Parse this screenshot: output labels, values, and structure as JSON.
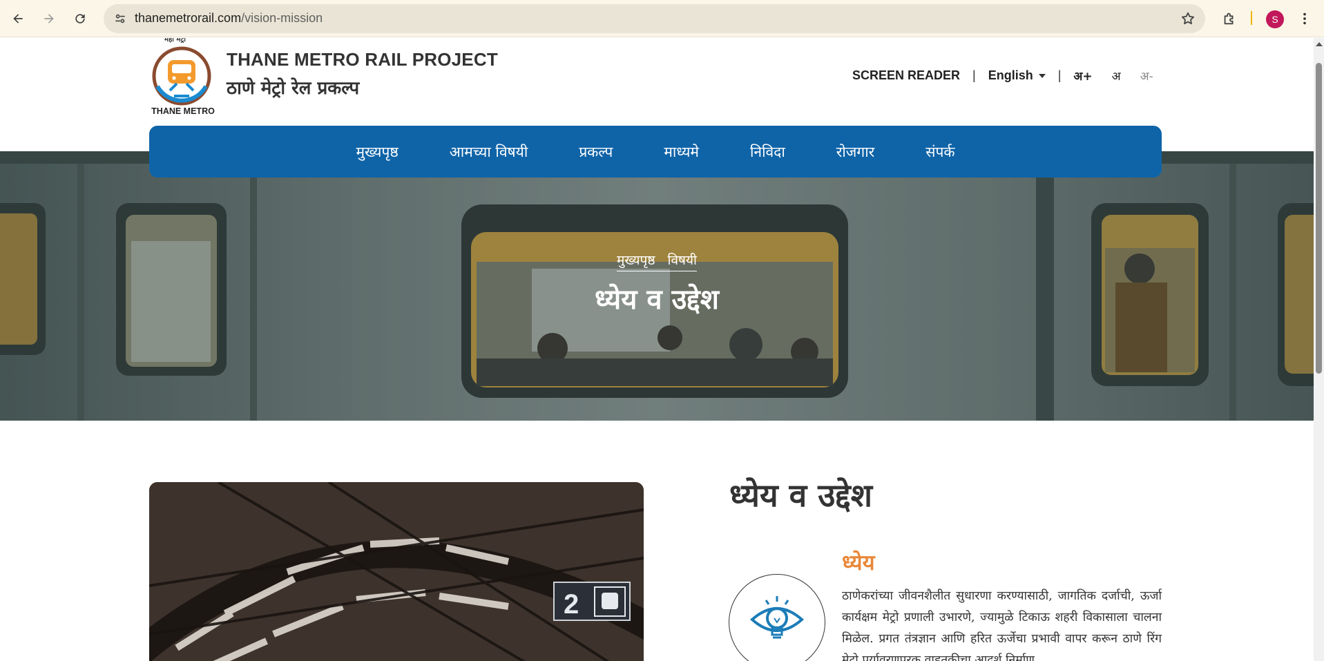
{
  "browser": {
    "url_domain": "thanemetrorail.com",
    "url_path": "/vision-mission",
    "profile_initial": "S",
    "accent_color": "#f0b400",
    "profile_color": "#c2185b"
  },
  "header": {
    "logo_top_text": "महा मेट्रो",
    "logo_bottom_text": "THANE METRO",
    "brand_en": "THANE METRO RAIL PROJECT",
    "brand_mr": "ठाणे मेट्रो रेल प्रकल्प",
    "screen_reader": "SCREEN READER",
    "separator": "|",
    "language": "English",
    "font_increase": "अ+",
    "font_normal": "अ",
    "font_decrease": "अ-"
  },
  "nav": {
    "items": [
      "मुख्यपृष्ठ",
      "आमच्या विषयी",
      "प्रकल्प",
      "माध्यमे",
      "निविदा",
      "रोजगार",
      "संपर्क"
    ],
    "color": "#0f64a8"
  },
  "hero": {
    "breadcrumb_home": "मुख्यपृष्ठ",
    "breadcrumb_current": "विषयी",
    "title": "ध्येय व उद्देश"
  },
  "content": {
    "section_title": "ध्येय व उद्देश",
    "platform_sign": "2",
    "vision_heading": "ध्येय",
    "vision_heading_color": "#e8883a",
    "vision_text": "ठाणेकरांच्या जीवनशैलीत सुधारणा करण्यासाठी, जागतिक दर्जाची, ऊर्जा कार्यक्षम मेट्रो प्रणाली उभारणे, ज्यामुळे टिकाऊ शहरी विकासाला चालना मिळेल. प्रगत तंत्रज्ञान आणि हरित ऊर्जेचा प्रभावी वापर करून ठाणे रिंग मेट्रो पर्यावरणपूरक वाहतुकीचा आदर्श निर्माण"
  }
}
